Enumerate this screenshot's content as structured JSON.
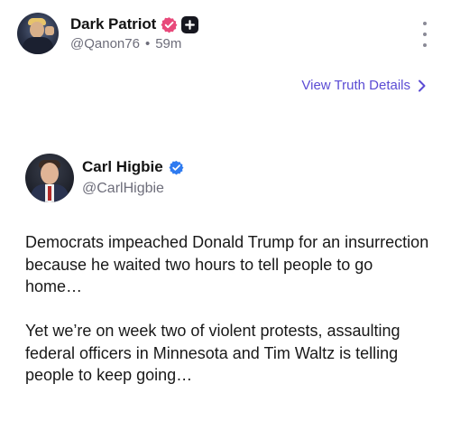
{
  "post": {
    "author": {
      "display_name": "Dark Patriot",
      "handle": "@Qanon76",
      "separator": "•",
      "age": "59m",
      "verified_badge_color": "#e8497a",
      "plus_badge_color": "#16171f"
    },
    "more_icon": "more-vertical-icon",
    "details_link": {
      "label": "View Truth Details",
      "color": "#5b4cd4",
      "icon": "chevron-right-icon"
    }
  },
  "embed": {
    "author": {
      "display_name": "Carl Higbie",
      "handle": "@CarlHigbie",
      "verified_badge_color": "#2f7bf0"
    },
    "paragraphs": [
      "Democrats impeached Donald Trump for an insurrection because he waited two hours to tell people to go home…",
      "Yet we’re on week two of violent protests, assaulting federal officers in Minnesota and Tim Waltz is telling people to keep going…"
    ]
  }
}
